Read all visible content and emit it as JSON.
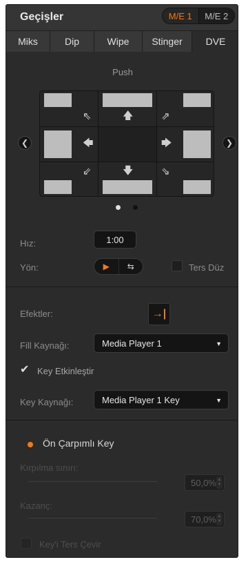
{
  "header": {
    "title": "Geçişler",
    "me_buttons": [
      {
        "label": "M/E 1",
        "active": true
      },
      {
        "label": "M/E 2",
        "active": false
      }
    ]
  },
  "tabs": [
    {
      "label": "Miks"
    },
    {
      "label": "Dip"
    },
    {
      "label": "Wipe"
    },
    {
      "label": "Stinger"
    },
    {
      "label": "DVE",
      "active": true
    }
  ],
  "dve": {
    "pattern_name": "Push",
    "page_count": 2,
    "active_page": 1
  },
  "rate": {
    "label": "Hız:",
    "value": "1:00"
  },
  "direction": {
    "label": "Yön:",
    "reverse_label": "Ters Düz",
    "reverse_checked": false
  },
  "effects": {
    "label": "Efektler:",
    "icon": "fly-in-icon",
    "glyph": "→|"
  },
  "fill_source": {
    "label": "Fill Kaynağı:",
    "value": "Media Player 1"
  },
  "enable_key": {
    "label": "Key Etkinleştir",
    "checked": true
  },
  "key_source": {
    "label": "Key Kaynağı:",
    "value": "Media Player 1 Key"
  },
  "premultiplied": {
    "label": "Ön Çarpımlı Key",
    "selected": true
  },
  "clip": {
    "label": "Kırpılma sınırı:",
    "value": "50,0%"
  },
  "gain": {
    "label": "Kazanç:",
    "value": "70,0%"
  },
  "invert_key": {
    "label": "Key'i Ters Çevir",
    "checked": false
  },
  "colors": {
    "accent": "#f07a1c",
    "panel": "#2b2b2b",
    "field": "#141414"
  }
}
